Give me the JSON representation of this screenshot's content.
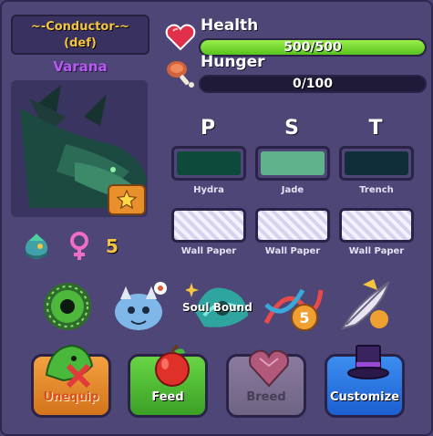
{
  "header": {
    "title_line1": "~-Conductor-~",
    "title_line2": "(def)",
    "dragon_name": "Varana"
  },
  "stats": {
    "health": {
      "label": "Health",
      "value_text": "500/500",
      "fill_fraction": 1.0,
      "icon": "heart-icon"
    },
    "hunger": {
      "label": "Hunger",
      "value_text": "0/100",
      "fill_fraction": 0.0,
      "icon": "meat-icon"
    }
  },
  "genes": {
    "letters": [
      "P",
      "S",
      "T"
    ],
    "colors": [
      {
        "name": "Hydra",
        "hex": "#0d4a3c"
      },
      {
        "name": "Jade",
        "hex": "#5fb38b"
      },
      {
        "name": "Trench",
        "hex": "#0f2e3a"
      }
    ],
    "patterns": [
      {
        "name": "Wall Paper"
      },
      {
        "name": "Wall Paper"
      },
      {
        "name": "Wall Paper"
      }
    ]
  },
  "mini_info": {
    "count": "5",
    "icons": [
      "dragon-species-icon",
      "female-gender-icon"
    ]
  },
  "traits": {
    "soul_bound_label": "Soul Bound",
    "dna_count": "5",
    "icons": [
      "eye-orb-icon",
      "baby-dragon-icon",
      "soul-bound-icon",
      "dna-icon",
      "feather-quill-icon"
    ]
  },
  "actions": {
    "unequip": "Unequip",
    "feed": "Feed",
    "breed": "Breed",
    "customize": "Customize"
  },
  "colors": {
    "panel_bg": "#4d4676",
    "health_bar": "#7ad83a",
    "name_purple": "#b55bf0",
    "title_gold": "#f5c542"
  }
}
